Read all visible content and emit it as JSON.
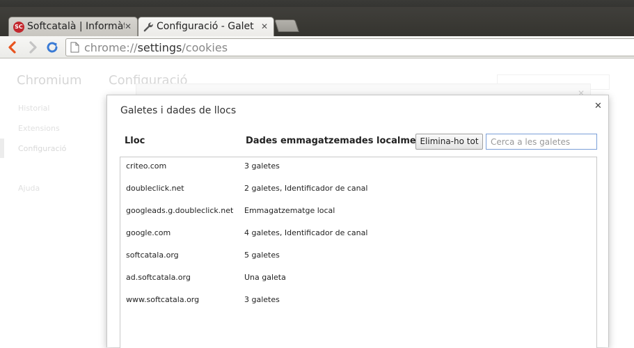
{
  "browser": {
    "tabs": [
      {
        "title": "Softcatalà | Informàtica",
        "favicon": "softcatala-icon",
        "active": false
      },
      {
        "title": "Configuració - Galetes",
        "favicon": "wrench-icon",
        "active": true
      }
    ],
    "omnibox": {
      "scheme": "chrome://",
      "host": "settings",
      "sep": "/",
      "path": "cookies"
    }
  },
  "settings_page": {
    "brand": "Chromium",
    "heading": "Configuració",
    "nav": [
      "Historial",
      "Extensions",
      "Configuració",
      "Ajuda"
    ]
  },
  "dialog": {
    "title": "Galetes i dades de llocs",
    "col_site": "Lloc",
    "col_data": "Dades emmagatzemades localment",
    "remove_all_label": "Elimina-ho tot",
    "search_placeholder": "Cerca a les galetes",
    "rows": [
      {
        "site": "criteo.com",
        "data": "3 galetes"
      },
      {
        "site": "doubleclick.net",
        "data": "2 galetes, Identificador de canal"
      },
      {
        "site": "googleads.g.doubleclick.net",
        "data": "Emmagatzematge local"
      },
      {
        "site": "google.com",
        "data": "4 galetes, Identificador de canal"
      },
      {
        "site": "softcatala.org",
        "data": "5 galetes"
      },
      {
        "site": "ad.softcatala.org",
        "data": "Una galeta"
      },
      {
        "site": "www.softcatala.org",
        "data": "3 galetes"
      }
    ]
  },
  "colors": {
    "accent_refresh": "#3a7bd5",
    "back_arrow": "#e8541f"
  }
}
